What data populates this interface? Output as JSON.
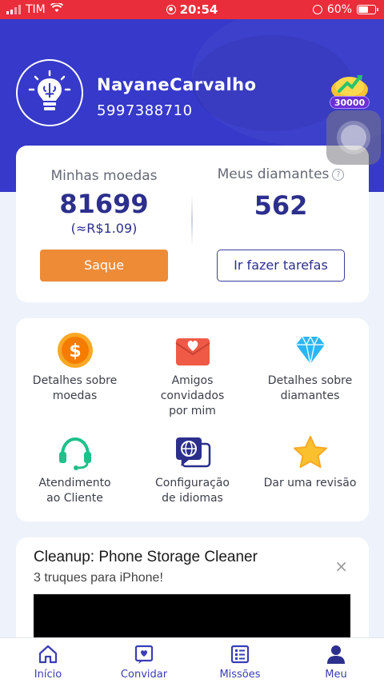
{
  "status_bar": {
    "carrier": "TIM",
    "time": "20:54",
    "battery": "60%"
  },
  "profile": {
    "username": "NayaneCarvalho",
    "user_id": "5997388710",
    "reward_badge": "30000"
  },
  "balance": {
    "coins_label": "Minhas moedas",
    "coins_value": "81699",
    "coins_equiv": "(≈R$1.09)",
    "diamonds_label": "Meus diamantes",
    "help_symbol": "?",
    "diamonds_value": "562",
    "withdraw_label": "Saque",
    "tasks_label": "Ir fazer tarefas"
  },
  "menu": {
    "items": [
      {
        "label": "Detalhes sobre moedas",
        "icon": "coin-icon"
      },
      {
        "label": "Amigos convidados por mim",
        "icon": "invite-envelope-icon"
      },
      {
        "label": "Detalhes sobre diamantes",
        "icon": "diamond-icon"
      },
      {
        "label": "Atendimento ao Cliente",
        "icon": "headset-icon"
      },
      {
        "label": "Configuração de idiomas",
        "icon": "language-globe-icon"
      },
      {
        "label": "Dar uma revisão",
        "icon": "star-icon"
      }
    ]
  },
  "ad": {
    "title": "Cleanup: Phone Storage Cleaner",
    "subtitle": "3 truques para iPhone!",
    "close_symbol": "×"
  },
  "tabs": [
    {
      "label": "Início",
      "icon": "home-icon"
    },
    {
      "label": "Convidar",
      "icon": "invite-icon"
    },
    {
      "label": "Missões",
      "icon": "missions-icon"
    },
    {
      "label": "Meu",
      "icon": "profile-icon"
    }
  ],
  "colors": {
    "header": "#3639c9",
    "accent_dark": "#2c2f8c",
    "withdraw_button": "#ee8b37",
    "status_bar": "#ea2d3a"
  }
}
